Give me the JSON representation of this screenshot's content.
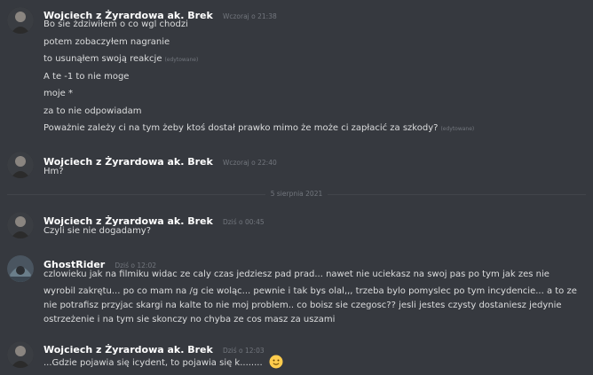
{
  "messages": [
    {
      "author": "Wojciech z Żyrardowa ak. Brek",
      "time": "Wczoraj o 21:38",
      "lines": [
        {
          "text": "Bo sie żdziwiłem o co wgl chodzi",
          "edited": ""
        },
        {
          "text": "potem zobaczyłem nagranie",
          "edited": ""
        },
        {
          "text": "to usunąłem swoją reakcje",
          "edited": "(edytowane)"
        },
        {
          "text": "A te -1 to nie moge",
          "edited": ""
        },
        {
          "text": "moje *",
          "edited": ""
        },
        {
          "text": "za to nie odpowiadam",
          "edited": ""
        },
        {
          "text": "Poważnie zależy ci na tym żeby ktoś dostał prawko mimo że może ci zapłacić za szkody?",
          "edited": "(edytowane)"
        }
      ]
    },
    {
      "author": "Wojciech z Żyrardowa ak. Brek",
      "time": "Wczoraj o 22:40",
      "lines": [
        {
          "text": "Hm?",
          "edited": ""
        }
      ]
    },
    {
      "author": "Wojciech z Żyrardowa ak. Brek",
      "time": "Dziś o 00:45",
      "lines": [
        {
          "text": "Czyli sie nie dogadamy?",
          "edited": ""
        }
      ]
    },
    {
      "author": "GhostRider",
      "time": "Dziś o 12:02",
      "lines": [
        {
          "text": "czlowieku jak na filmiku widac ze caly czas jedziesz pad prad...  nawet nie uciekasz  na swoj pas po tym jak zes nie",
          "edited": ""
        },
        {
          "text": "wyrobil zakrętu... po co mam na /g cie woląc... pewnie i tak bys olal,,,  trzeba bylo pomyslec  po tym incydencie... a to ze",
          "edited": ""
        },
        {
          "text": "nie potrafisz przyjac skargi na kalte to nie moj problem.. co boisz sie czegosc??    jesli jestes czysty dostaniesz jedynie",
          "edited": ""
        },
        {
          "text": "ostrzeżenie i na tym sie skonczy no chyba ze cos masz za uszami",
          "edited": ""
        }
      ]
    },
    {
      "author": "Wojciech z Żyrardowa ak. Brek",
      "time": "Dziś o 12:03",
      "lines": [
        {
          "text": "...Gdzie pojawia się icydent, to pojawia się k........",
          "edited": ""
        }
      ]
    }
  ],
  "divider": {
    "label": "5 sierpnia 2021"
  },
  "icons": {
    "emoji": "slightly-smiling-face-icon"
  },
  "colors": {
    "background": "#36393f",
    "username": "#ffffff",
    "text": "#dcddde",
    "muted": "#72767d"
  }
}
